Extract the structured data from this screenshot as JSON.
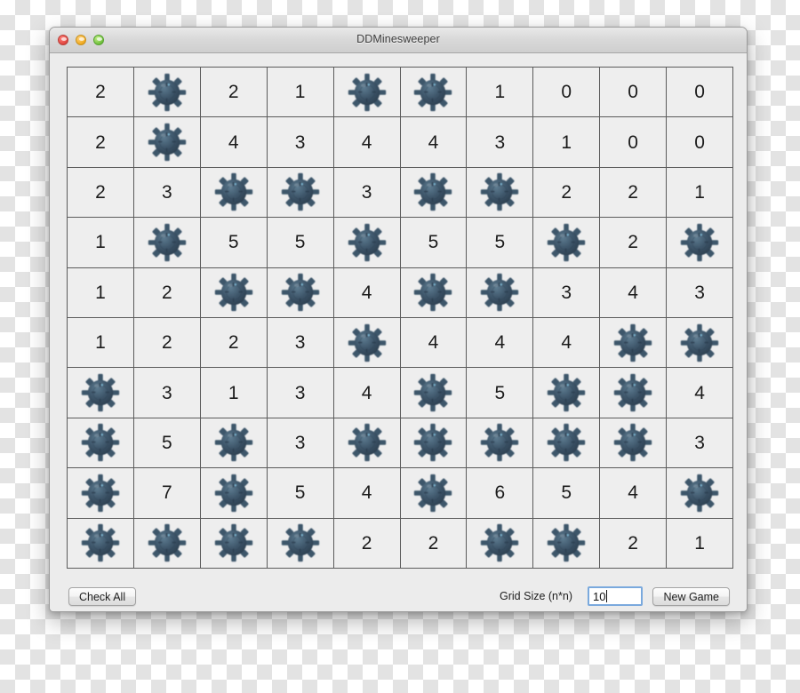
{
  "window": {
    "title": "DDMinesweeper",
    "controls": [
      {
        "name": "close",
        "label": "Close"
      },
      {
        "name": "minimize",
        "label": "Minimize"
      },
      {
        "name": "zoom",
        "label": "Zoom"
      }
    ]
  },
  "board": {
    "rows": 10,
    "cols": 10,
    "mine_token": "M",
    "cells": [
      [
        "2",
        "M",
        "2",
        "1",
        "M",
        "M",
        "1",
        "0",
        "0",
        "0"
      ],
      [
        "2",
        "M",
        "4",
        "3",
        "4",
        "4",
        "3",
        "1",
        "0",
        "0"
      ],
      [
        "2",
        "3",
        "M",
        "M",
        "3",
        "M",
        "M",
        "2",
        "2",
        "1"
      ],
      [
        "1",
        "M",
        "5",
        "5",
        "M",
        "5",
        "5",
        "M",
        "2",
        "M"
      ],
      [
        "1",
        "2",
        "M",
        "M",
        "4",
        "M",
        "M",
        "3",
        "4",
        "3"
      ],
      [
        "1",
        "2",
        "2",
        "3",
        "M",
        "4",
        "4",
        "4",
        "M",
        "M"
      ],
      [
        "M",
        "3",
        "1",
        "3",
        "4",
        "M",
        "5",
        "M",
        "M",
        "4"
      ],
      [
        "M",
        "5",
        "M",
        "3",
        "M",
        "M",
        "M",
        "M",
        "M",
        "3"
      ],
      [
        "M",
        "7",
        "M",
        "5",
        "4",
        "M",
        "6",
        "5",
        "4",
        "M"
      ],
      [
        "M",
        "M",
        "M",
        "M",
        "2",
        "2",
        "M",
        "M",
        "2",
        "1"
      ]
    ]
  },
  "toolbar": {
    "check_all_label": "Check All",
    "grid_size_label": "Grid Size (n*n)",
    "grid_size_value": "10",
    "grid_size_placeholder": "10",
    "new_game_label": "New Game"
  },
  "colors": {
    "mine_body": "#3e566a",
    "mine_dark": "#2c3f50",
    "mine_highlight": "#7fb7d4",
    "cell_background": "#eeeeee",
    "grid_line": "#5b5b5b",
    "window_chrome": "#ececec",
    "input_focus_border": "#7aa9dd"
  }
}
